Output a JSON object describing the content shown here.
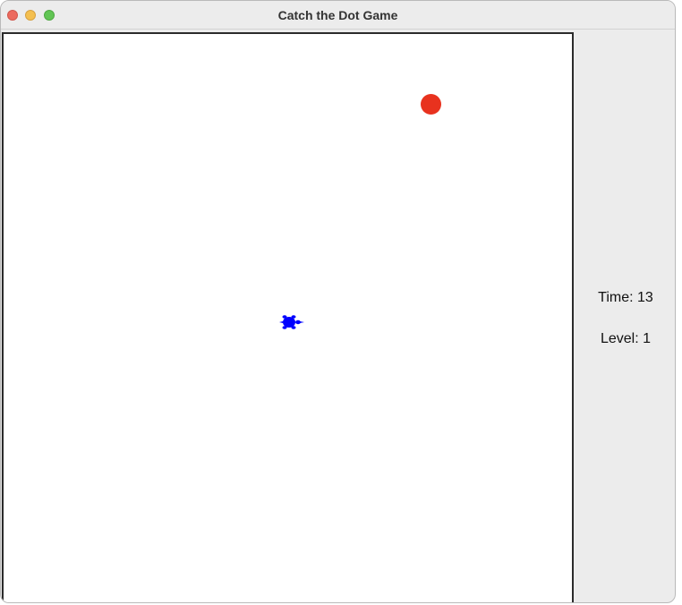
{
  "window": {
    "title": "Catch the Dot Game"
  },
  "game": {
    "target_dot_color": "#e8321e",
    "player_color": "#0000ff",
    "player_icon": "turtle-icon"
  },
  "sidebar": {
    "time_label": "Time: 13",
    "level_label": "Level: 1"
  }
}
